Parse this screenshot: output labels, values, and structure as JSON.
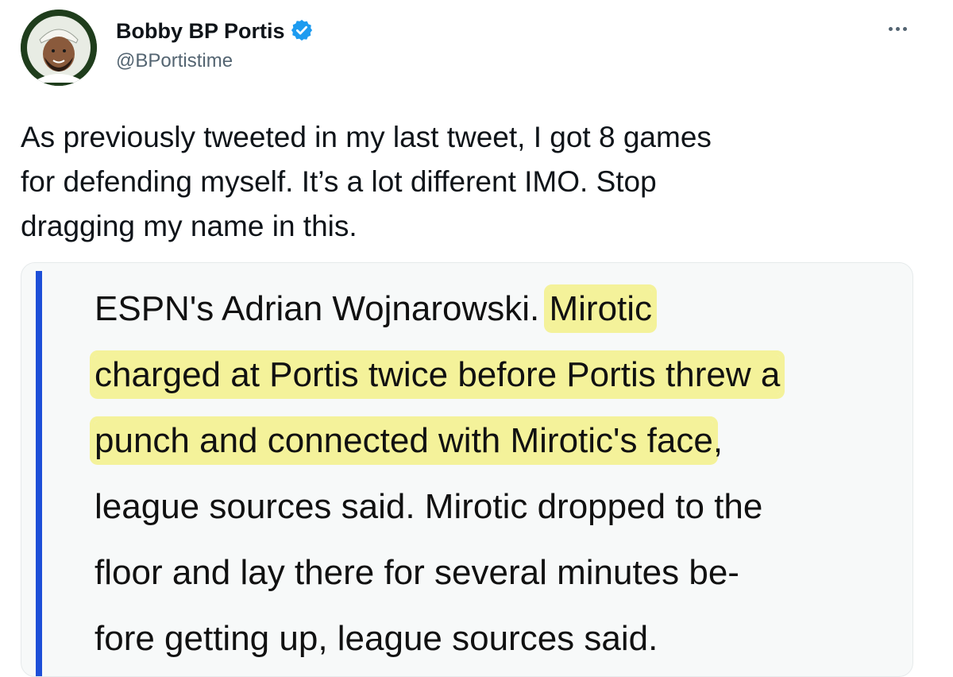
{
  "author": {
    "display_name": "Bobby BP Portis",
    "handle": "@BPortistime",
    "verified": true
  },
  "tweet": {
    "text_lines": [
      "As previously tweeted in my last tweet, I got 8 games",
      "for defending myself. It’s a lot different IMO. Stop",
      "dragging my name in this."
    ]
  },
  "quote": {
    "lines": [
      {
        "plain": "ESPN's Adrian Wojnarowski. ",
        "highlight": "Mirotic"
      },
      {
        "plain": "",
        "highlight": "charged at Portis twice before Portis threw a"
      },
      {
        "plain": "",
        "highlight": "punch and connected with Mirotic's face",
        "after": ","
      },
      {
        "plain": "league sources said. Mirotic dropped to the",
        "highlight": ""
      },
      {
        "plain": "floor and lay there for several minutes be-",
        "highlight": ""
      },
      {
        "plain": "fore getting up, league sources said.",
        "highlight": ""
      }
    ]
  },
  "icons": {
    "verified": "verified-check-icon",
    "more": "more-options-icon"
  },
  "colors": {
    "verified_blue": "#1d9bf0",
    "quote_bar": "#1d4fd8",
    "highlight": "#f4f29a",
    "secondary_text": "#536471"
  }
}
